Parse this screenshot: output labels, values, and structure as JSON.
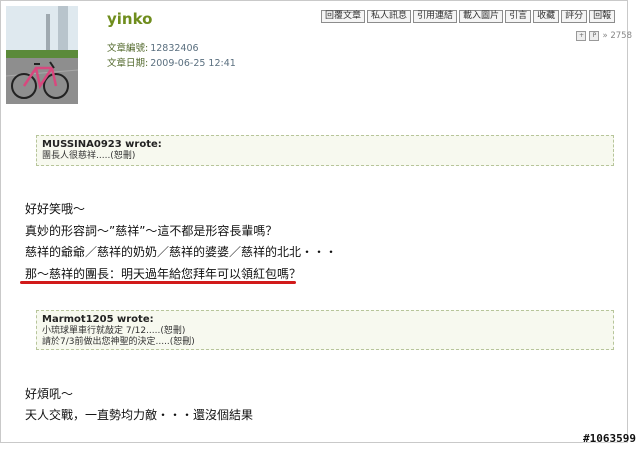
{
  "post": {
    "username": "yinko",
    "article_id_label": "文章編號:",
    "article_id": "12832406",
    "article_date_label": "文章日期:",
    "article_date": "2009-06-25 12:41",
    "view_count": "» 2758"
  },
  "toolbar": [
    "回覆文章",
    "私人訊息",
    "引用連結",
    "載入圖片",
    "引言",
    "收藏",
    "評分",
    "回報"
  ],
  "quote1": {
    "author": "MUSSINA0923 wrote:",
    "lines": [
      "團長人很慈祥.....(恕刪)"
    ]
  },
  "body1": [
    "好好笑哦～",
    "真妙的形容詞～”慈祥”～這不都是形容長輩嗎？",
    "慈祥的爺爺／慈祥的奶奶／慈祥的婆婆／慈祥的北北・・・",
    "那～慈祥的團長：明天過年給您拜年可以領紅包嗎？"
  ],
  "quote2": {
    "author": "Marmot1205 wrote:",
    "lines": [
      "小琉球單車行就敲定 7/12.....(恕刪)",
      "請於7/3前做出您神聖的決定.....(恕刪)"
    ]
  },
  "body2": [
    "好煩吼～",
    "天人交戰，一直勢均力敵・・・還沒個結果"
  ],
  "watermark": "#1063599"
}
